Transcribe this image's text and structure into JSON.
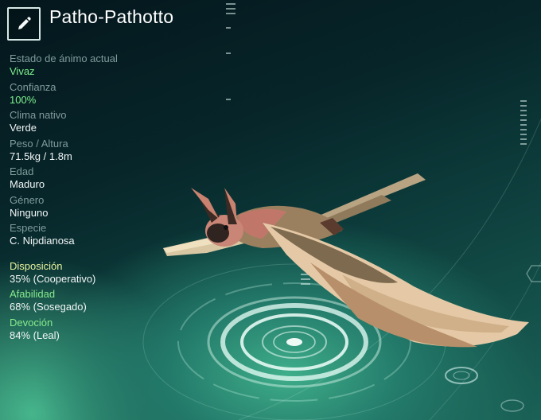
{
  "pal": {
    "name": "Patho-Pathotto",
    "edit_icon": "pencil-icon"
  },
  "stats": [
    {
      "label": "Estado de ánimo actual",
      "value": "Vivaz"
    },
    {
      "label": "Confianza",
      "value": "100%"
    },
    {
      "label": "Clima nativo",
      "value": "Verde"
    },
    {
      "label": "Peso / Altura",
      "value": "71.5kg / 1.8m"
    },
    {
      "label": "Edad",
      "value": "Maduro"
    },
    {
      "label": "Género",
      "value": "Ninguno"
    },
    {
      "label": "Especie",
      "value": "C. Nipdianosa"
    }
  ],
  "traits": [
    {
      "label": "Disposición",
      "value": "35% (Cooperativo)"
    },
    {
      "label": "Afabilidad",
      "value": "68% (Sosegado)"
    },
    {
      "label": "Devoción",
      "value": "84% (Leal)"
    }
  ],
  "colors": {
    "accent_green": "#7ef08e",
    "trait_yellow": "#e6f19a",
    "trait_green": "#86ec8c"
  }
}
